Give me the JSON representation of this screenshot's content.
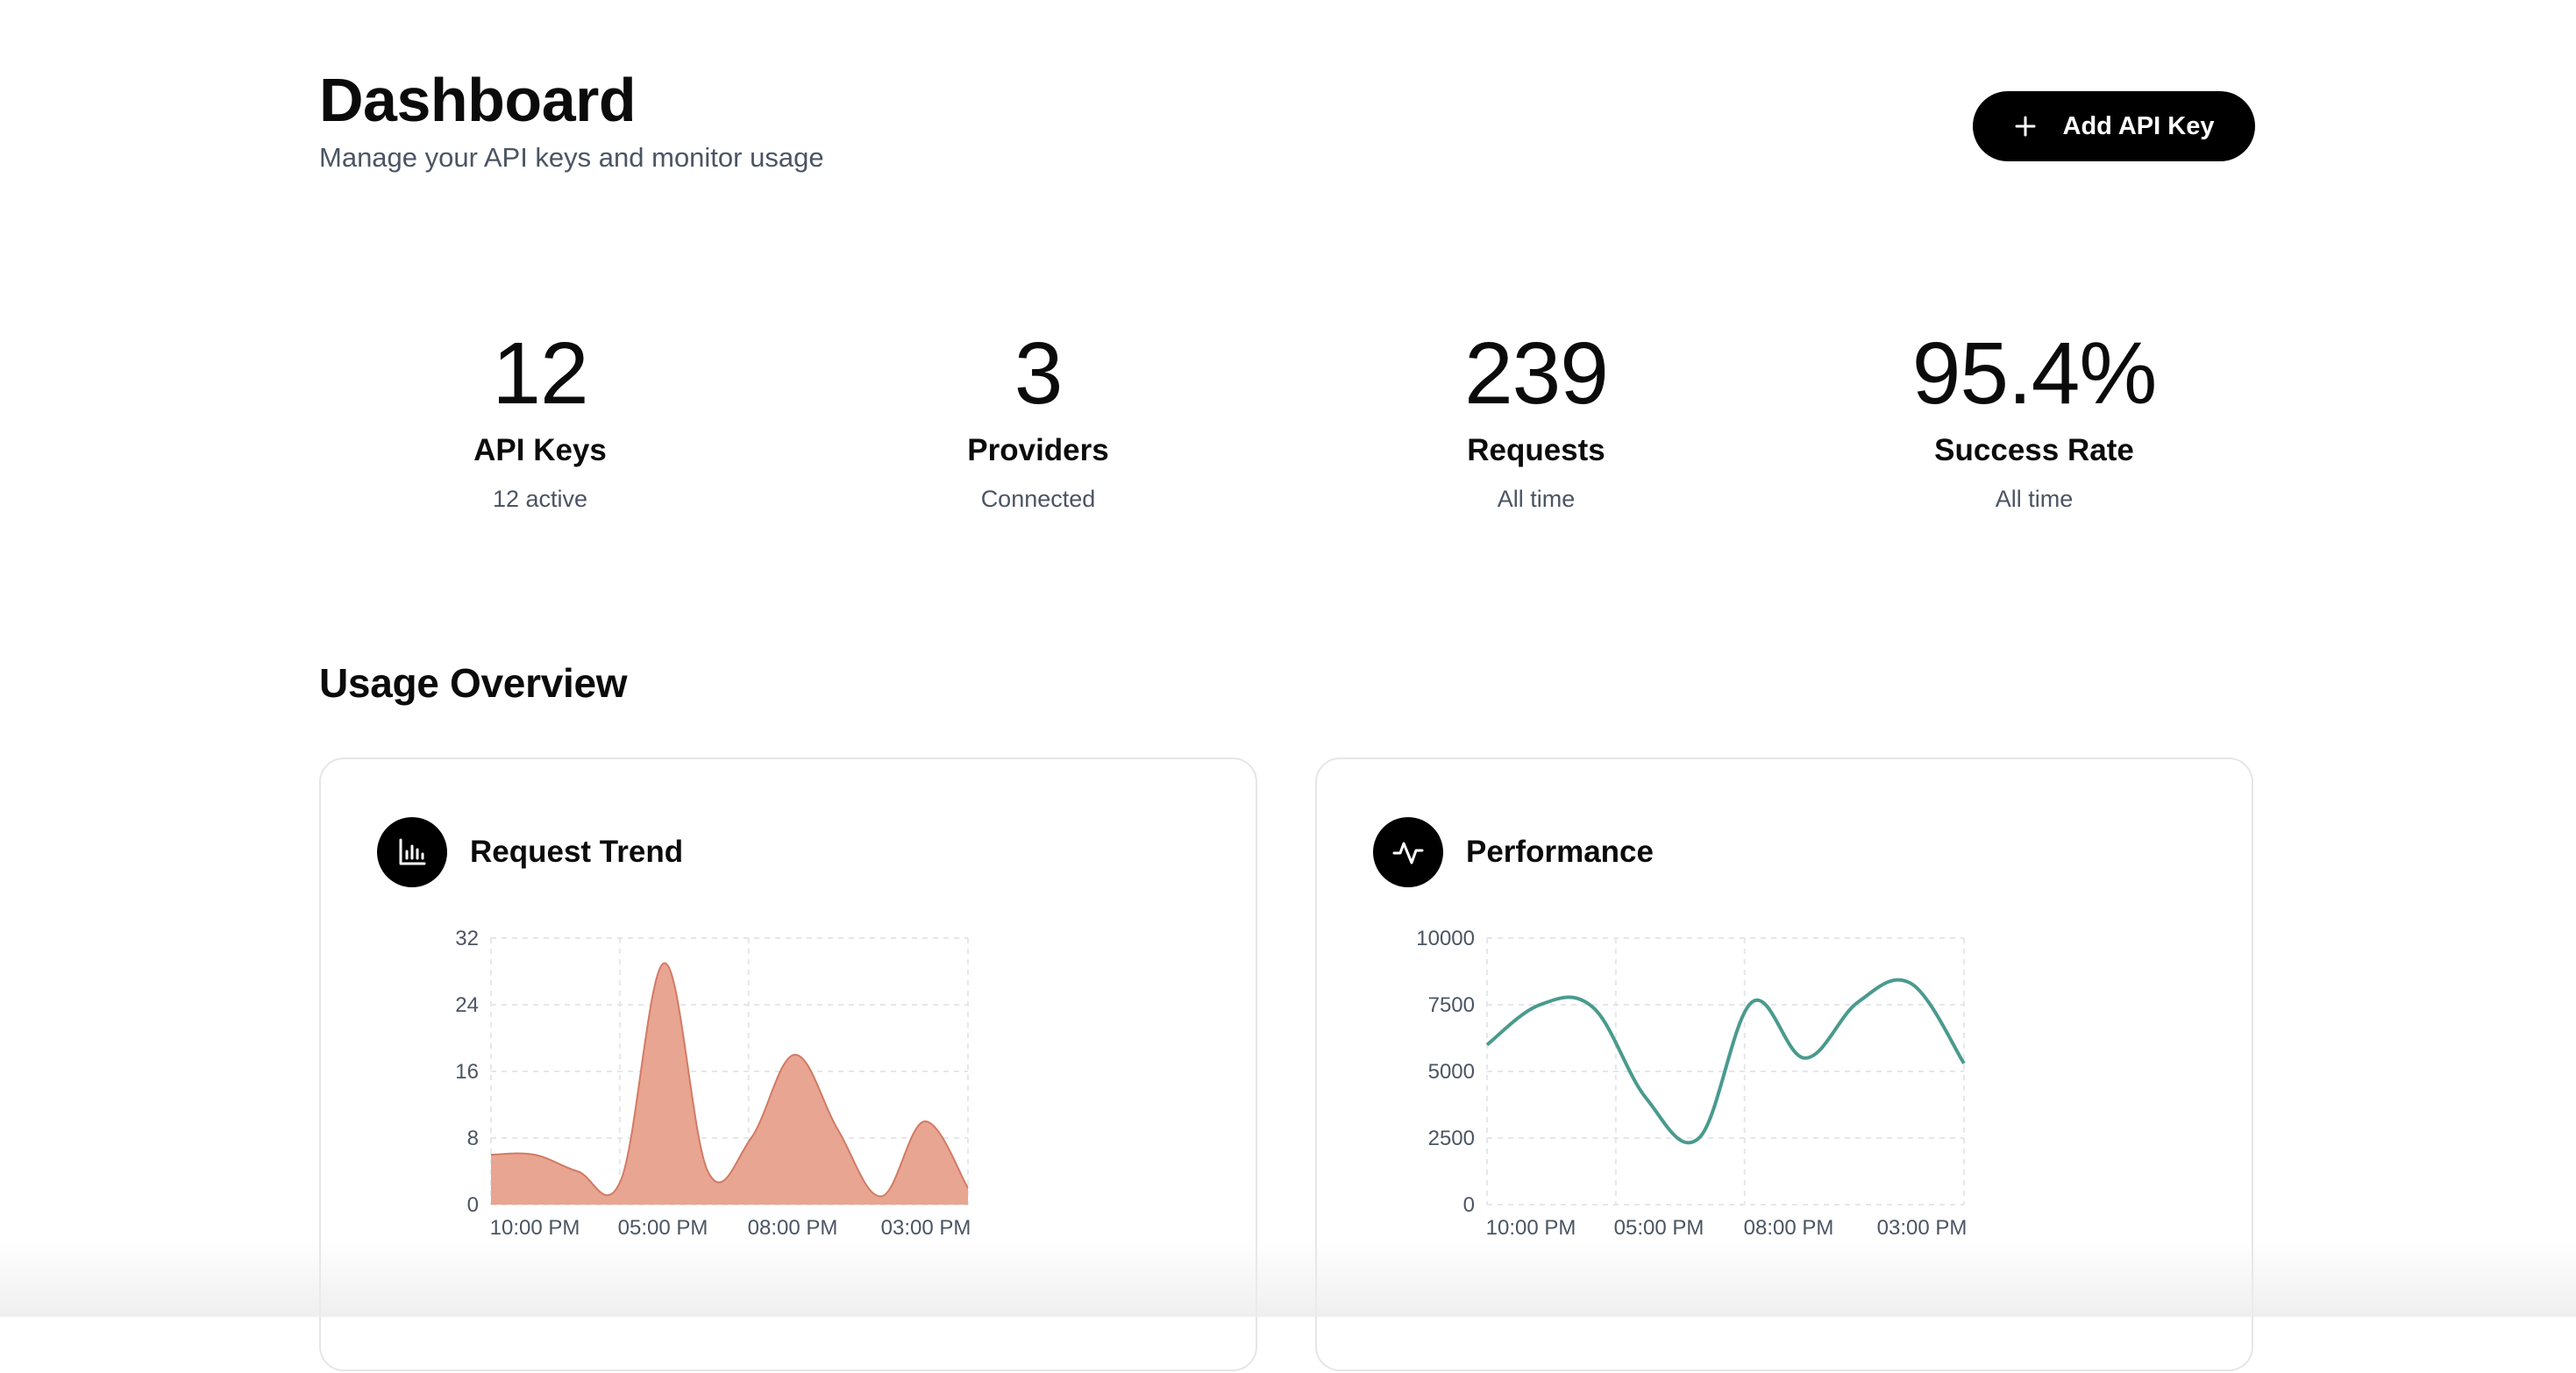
{
  "header": {
    "title": "Dashboard",
    "subtitle": "Manage your API keys and monitor usage",
    "add_button_label": "Add API Key"
  },
  "stats": [
    {
      "value": "12",
      "label": "API Keys",
      "sub": "12 active"
    },
    {
      "value": "3",
      "label": "Providers",
      "sub": "Connected"
    },
    {
      "value": "239",
      "label": "Requests",
      "sub": "All time"
    },
    {
      "value": "95.4%",
      "label": "Success Rate",
      "sub": "All time"
    }
  ],
  "usage": {
    "title": "Usage Overview",
    "cards": [
      {
        "title": "Request Trend",
        "icon": "bar-chart-icon"
      },
      {
        "title": "Performance",
        "icon": "activity-icon"
      }
    ]
  },
  "colors": {
    "primary": "#000000",
    "area_fill": "#e8a592",
    "area_stroke": "#d27a63",
    "line": "#4a9a8e",
    "muted_text": "#4b5563"
  },
  "chart_data": [
    {
      "type": "area",
      "x_ticks": [
        "10:00 PM",
        "05:00 PM",
        "08:00 PM",
        "03:00 PM"
      ],
      "y_ticks": [
        0,
        8,
        16,
        24,
        32
      ],
      "ylim": [
        0,
        32
      ],
      "x": [
        0,
        1,
        2,
        3,
        4,
        5,
        6,
        7,
        8,
        9,
        10,
        11
      ],
      "values": [
        6,
        6,
        4,
        3,
        29,
        4,
        8,
        18,
        9,
        1,
        10,
        2
      ],
      "title": "Request Trend"
    },
    {
      "type": "line",
      "x_ticks": [
        "10:00 PM",
        "05:00 PM",
        "08:00 PM",
        "03:00 PM"
      ],
      "y_ticks": [
        0,
        2500,
        5000,
        7500,
        10000
      ],
      "ylim": [
        0,
        10000
      ],
      "x": [
        0,
        1,
        2,
        3,
        4,
        5,
        6,
        7,
        8,
        9,
        10,
        11
      ],
      "values": [
        6000,
        7500,
        7400,
        4000,
        2500,
        7600,
        5500,
        7600,
        8300,
        5300
      ],
      "title": "Performance"
    }
  ]
}
